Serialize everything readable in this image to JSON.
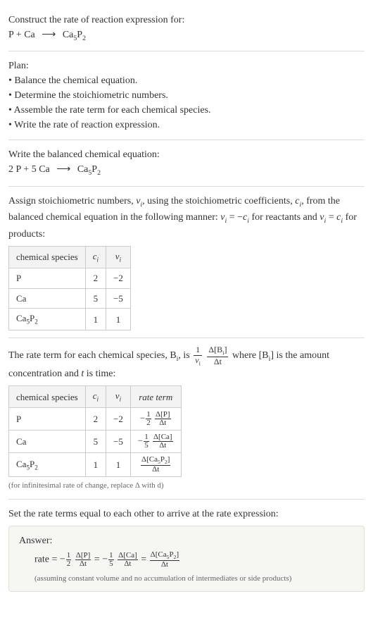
{
  "prompt": {
    "intro": "Construct the rate of reaction expression for:",
    "reaction_lhs1": "P",
    "plus": " + ",
    "reaction_lhs2": "Ca",
    "arrow": "⟶",
    "reaction_rhs_base": "Ca",
    "reaction_rhs_sub1": "5",
    "reaction_rhs_mid": "P",
    "reaction_rhs_sub2": "2"
  },
  "plan": {
    "heading": "Plan:",
    "items": [
      "Balance the chemical equation.",
      "Determine the stoichiometric numbers.",
      "Assemble the rate term for each chemical species.",
      "Write the rate of reaction expression."
    ]
  },
  "balanced": {
    "heading": "Write the balanced chemical equation:",
    "coef1": "2 ",
    "sp1": "P",
    "plus": " + ",
    "coef2": "5 ",
    "sp2": "Ca",
    "arrow": "⟶",
    "prod_base": "Ca",
    "prod_sub1": "5",
    "prod_mid": "P",
    "prod_sub2": "2"
  },
  "stoich": {
    "text1": "Assign stoichiometric numbers, ",
    "nu_i": "ν",
    "sub_i": "i",
    "text2": ", using the stoichiometric coefficients, ",
    "c_i": "c",
    "text3": ", from the balanced chemical equation in the following manner: ",
    "eq1_lhs": "ν",
    "eq1_eq": " = −",
    "eq1_rhs": "c",
    "text4": " for reactants and ",
    "eq2_lhs": "ν",
    "eq2_eq": " = ",
    "eq2_rhs": "c",
    "text5": " for products:",
    "headers": {
      "species": "chemical species",
      "ci": "c",
      "ci_sub": "i",
      "nui": "ν",
      "nui_sub": "i"
    },
    "rows": [
      {
        "species": "P",
        "ci": "2",
        "nui": "−2"
      },
      {
        "species": "Ca",
        "ci": "5",
        "nui": "−5"
      },
      {
        "species_base": "Ca",
        "species_sub1": "5",
        "species_mid": "P",
        "species_sub2": "2",
        "ci": "1",
        "nui": "1"
      }
    ]
  },
  "rateterm": {
    "text1": "The rate term for each chemical species, B",
    "sub_i": "i",
    "text2": ", is ",
    "one": "1",
    "nu_i": "ν",
    "delta": "Δ",
    "lbrack": "[B",
    "rbrack": "]",
    "dt": "Δt",
    "text3": " where [B",
    "text4": "] is the amount concentration and ",
    "t": "t",
    "text5": " is time:",
    "headers": {
      "species": "chemical species",
      "ci": "c",
      "ci_sub": "i",
      "nui": "ν",
      "nui_sub": "i",
      "rate": "rate term"
    },
    "rows": [
      {
        "species": "P",
        "ci": "2",
        "nui": "−2",
        "neg": "−",
        "half_num": "1",
        "half_den": "2",
        "dnum": "Δ[P]",
        "dden": "Δt"
      },
      {
        "species": "Ca",
        "ci": "5",
        "nui": "−5",
        "neg": "−",
        "half_num": "1",
        "half_den": "5",
        "dnum": "Δ[Ca]",
        "dden": "Δt"
      },
      {
        "species_base": "Ca",
        "species_sub1": "5",
        "species_mid": "P",
        "species_sub2": "2",
        "ci": "1",
        "nui": "1",
        "dnum_pre": "Δ[Ca",
        "dnum_sub1": "5",
        "dnum_mid": "P",
        "dnum_sub2": "2",
        "dnum_post": "]",
        "dden": "Δt"
      }
    ],
    "note": "(for infinitesimal rate of change, replace Δ with d)"
  },
  "conclusion": {
    "text": "Set the rate terms equal to each other to arrive at the rate expression:"
  },
  "answer": {
    "label": "Answer:",
    "rate": "rate = ",
    "neg": "−",
    "t1_num": "1",
    "t1_den": "2",
    "f1_num": "Δ[P]",
    "f1_den": "Δt",
    "eq": " = ",
    "t2_num": "1",
    "t2_den": "5",
    "f2_num": "Δ[Ca]",
    "f2_den": "Δt",
    "f3_num_pre": "Δ[Ca",
    "f3_sub1": "5",
    "f3_mid": "P",
    "f3_sub2": "2",
    "f3_num_post": "]",
    "f3_den": "Δt",
    "note": "(assuming constant volume and no accumulation of intermediates or side products)"
  }
}
